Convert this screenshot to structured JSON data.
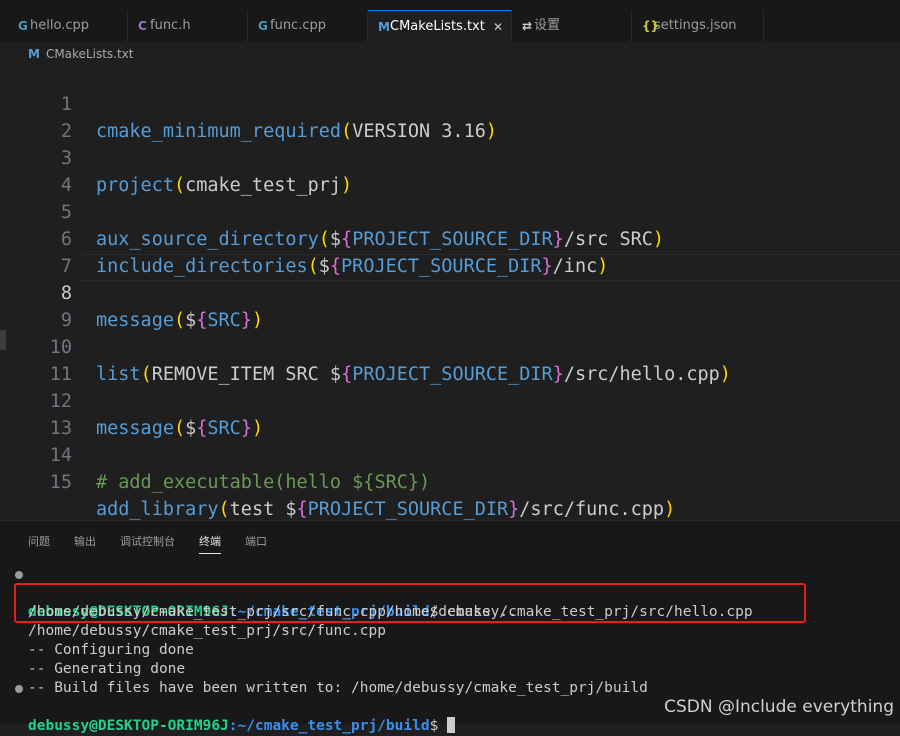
{
  "tabs": [
    {
      "icon": "G",
      "label": "hello.cpp",
      "icon_color": "#519aba"
    },
    {
      "icon": "C",
      "label": "func.h",
      "icon_color": "#a074c4"
    },
    {
      "icon": "G",
      "label": "func.cpp",
      "icon_color": "#519aba"
    },
    {
      "icon": "M",
      "label": "CMakeLists.txt",
      "icon_color": "#569cd6",
      "close": "✕"
    },
    {
      "icon": "⇄",
      "label": "设置",
      "icon_color": "#cccccc"
    },
    {
      "icon": "{}",
      "label": "settings.json",
      "icon_color": "#cbcb41"
    }
  ],
  "breadcrumb": {
    "icon": "M",
    "label": "CMakeLists.txt"
  },
  "editor": {
    "current_line": 8,
    "lines": [
      {
        "n": "1",
        "parts": [
          "cmake_minimum_required",
          "(",
          "VERSION 3.16",
          ")"
        ]
      },
      {
        "n": "2"
      },
      {
        "n": "3",
        "parts": [
          "project",
          "(",
          "cmake_test_prj",
          ")"
        ]
      },
      {
        "n": "4"
      },
      {
        "n": "5",
        "parts": [
          "aux_source_directory",
          "(",
          "$",
          "{",
          "PROJECT_SOURCE_DIR",
          "}",
          "/src SRC",
          ")"
        ]
      },
      {
        "n": "6",
        "parts": [
          "include_directories",
          "(",
          "$",
          "{",
          "PROJECT_SOURCE_DIR",
          "}",
          "/inc",
          ")"
        ]
      },
      {
        "n": "7"
      },
      {
        "n": "8",
        "parts": [
          "message",
          "(",
          "$",
          "{",
          "SRC",
          "}",
          ")"
        ]
      },
      {
        "n": "9"
      },
      {
        "n": "10",
        "parts": [
          "list",
          "(",
          "REMOVE_ITEM SRC ",
          "$",
          "{",
          "PROJECT_SOURCE_DIR",
          "}",
          "/src/hello.cpp",
          ")"
        ]
      },
      {
        "n": "11"
      },
      {
        "n": "12",
        "parts": [
          "message",
          "(",
          "$",
          "{",
          "SRC",
          "}",
          ")"
        ]
      },
      {
        "n": "13"
      },
      {
        "n": "14",
        "comment": "# add_executable(hello ${SRC})"
      },
      {
        "n": "15",
        "parts": [
          "add_library",
          "(",
          "test ",
          "$",
          "{",
          "PROJECT_SOURCE_DIR",
          "}",
          "/src/func.cpp",
          ")"
        ]
      }
    ]
  },
  "panel": {
    "tabs": [
      "问题",
      "输出",
      "调试控制台",
      "终端",
      "端口"
    ],
    "active_tab": "终端"
  },
  "terminal": {
    "prompt_user": "debussy@DESKTOP-ORIM96J",
    "prompt_path": ":~/cmake_test_prj/build",
    "command": "$ cmake ..",
    "output": [
      "/home/debussy/cmake_test_prj/src/func.cpp/home/debussy/cmake_test_prj/src/hello.cpp",
      "/home/debussy/cmake_test_prj/src/func.cpp",
      "-- Configuring done",
      "-- Generating done",
      "-- Build files have been written to: /home/debussy/cmake_test_prj/build"
    ],
    "prompt_end": "$ "
  },
  "watermark": "CSDN @Include everything"
}
